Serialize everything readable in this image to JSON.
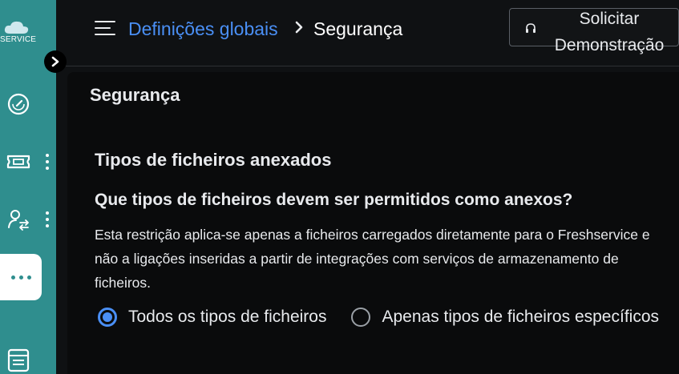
{
  "sidebar": {
    "brand_text": "SERVICE",
    "items": [
      {
        "icon": "gauge-icon"
      },
      {
        "icon": "ticket-icon"
      },
      {
        "icon": "user-switch-icon"
      },
      {
        "icon": "more-horizontal-icon"
      },
      {
        "icon": "calendar-grid-icon"
      }
    ]
  },
  "header": {
    "breadcrumb_root": "Definições globais",
    "breadcrumb_current": "Segurança",
    "demo_button_label": "Solicitar Demonstração"
  },
  "main": {
    "section_title": "Segurança",
    "subsection_title": "Tipos de ficheiros anexados",
    "question": "Que tipos de ficheiros devem ser permitidos como anexos?",
    "description": "Esta restrição aplica-se apenas a ficheiros carregados diretamente para o Freshservice e não a ligações inseridas a partir de integrações com serviços de armazenamento de ficheiros.",
    "options": [
      {
        "label": "Todos os tipos de ficheiros",
        "selected": true
      },
      {
        "label": "Apenas tipos de ficheiros específicos",
        "selected": false
      }
    ]
  },
  "colors": {
    "rail": "#2f8e8e",
    "accent": "#4a8ff5",
    "background": "#0f1113"
  }
}
